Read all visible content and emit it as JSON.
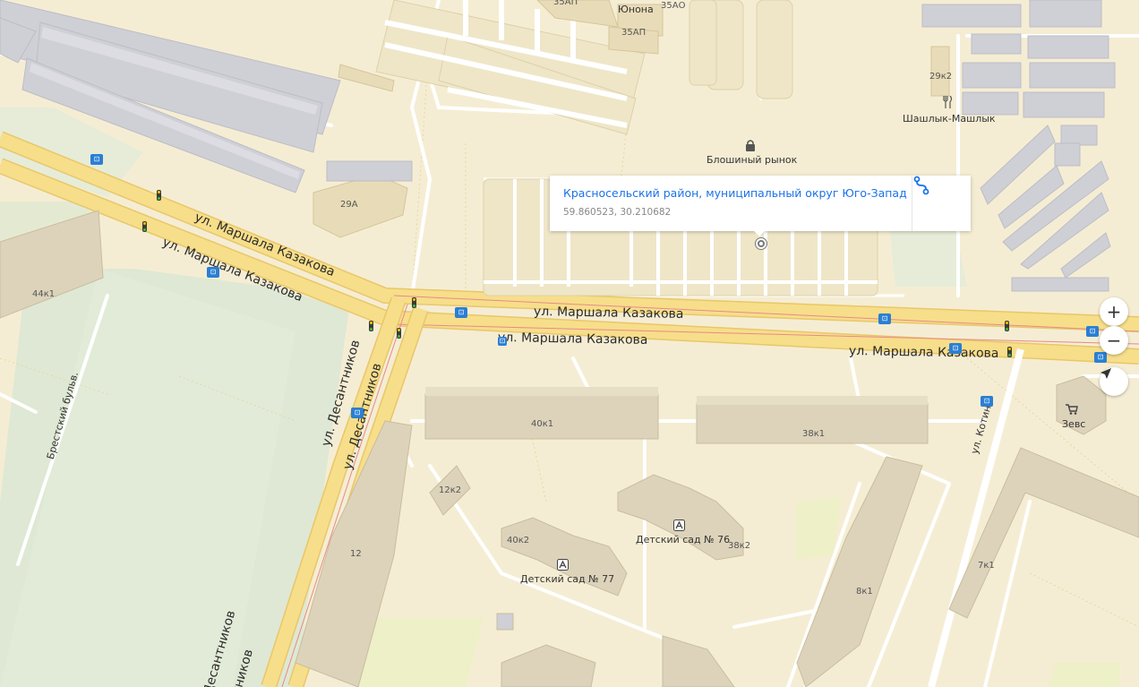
{
  "streets": {
    "kazakova_1": "ул. Маршала Казакова",
    "kazakova_2": "ул. Маршала Казакова",
    "kazakova_3": "ул. Маршала Казакова",
    "kazakova_4": "ул. Маршала Казакова",
    "kazakova_5": "ул. Маршала Казакова",
    "desantnikov_1": "ул. Десантников",
    "desantnikov_2": "ул. Десантников",
    "desantnikov_3": "Десантников",
    "desantnikov_4": "тников",
    "brestsky": "Брестский бульв.",
    "kotina": "ул. Котина"
  },
  "buildings": {
    "b35ap_top": "35АП",
    "b35ao": "35АО",
    "b35ap": "35АП",
    "b29k2": "29к2",
    "b29a": "29А",
    "b44k1": "44к1",
    "b40k1": "40к1",
    "b38k1": "38к1",
    "b12k2": "12к2",
    "b40k2": "40к2",
    "b38k2": "38к2",
    "b12": "12",
    "b8k1": "8к1",
    "b7k1": "7к1"
  },
  "pois": {
    "yunona": "Юнона",
    "shashlyk": "Шашлык-Машлык",
    "flea_market": "Блошиный рынок",
    "zevs": "Зевс",
    "kindergarten_76": "Детский сад № 76",
    "kindergarten_77": "Детский сад № 77"
  },
  "popup": {
    "title": "Красносельский район, муниципальный округ Юго-Запад",
    "coords": "59.860523, 30.210682"
  },
  "controls": {
    "zoom_in": "+",
    "zoom_out": "−"
  },
  "colors": {
    "background": "#f5edd3",
    "road": "#f7de8a",
    "link": "#1a73e8",
    "transport_stop": "#2a7fd4"
  },
  "icons": {
    "route": "route-icon",
    "locate": "locate-arrow-icon",
    "lock": "lock-icon",
    "fork": "fork-knife-icon",
    "cart": "cart-icon",
    "school": "school-icon",
    "bus_stop": "bus-stop-icon",
    "traffic_light": "traffic-light-icon"
  }
}
